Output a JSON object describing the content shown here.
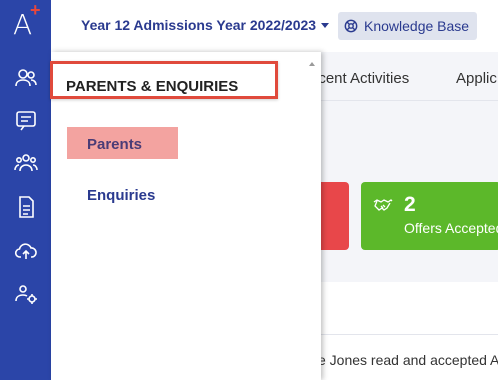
{
  "logo": {
    "letter": "A",
    "plus": "+"
  },
  "rail_icons": [
    "users-icon",
    "message-icon",
    "user-group-icon",
    "document-icon",
    "cloud-upload-icon",
    "user-settings-icon"
  ],
  "header": {
    "year_select": "Year 12 Admissions Year 2022/2023",
    "kb_button": "Knowledge Base"
  },
  "tabs": [
    "ecent Activities",
    "Applic"
  ],
  "cards": {
    "offers_count": "2",
    "offers_label": "Offers Accepted"
  },
  "activity_text": "e Jones read and accepted A",
  "dropdown": {
    "title": "PARENTS & ENQUIRIES",
    "items": [
      "Parents",
      "Enquiries"
    ]
  },
  "colors": {
    "rail": "#2b45a8",
    "accent_red": "#e04a3c",
    "highlight": "#f3a3a0",
    "green": "#5cb82a"
  }
}
